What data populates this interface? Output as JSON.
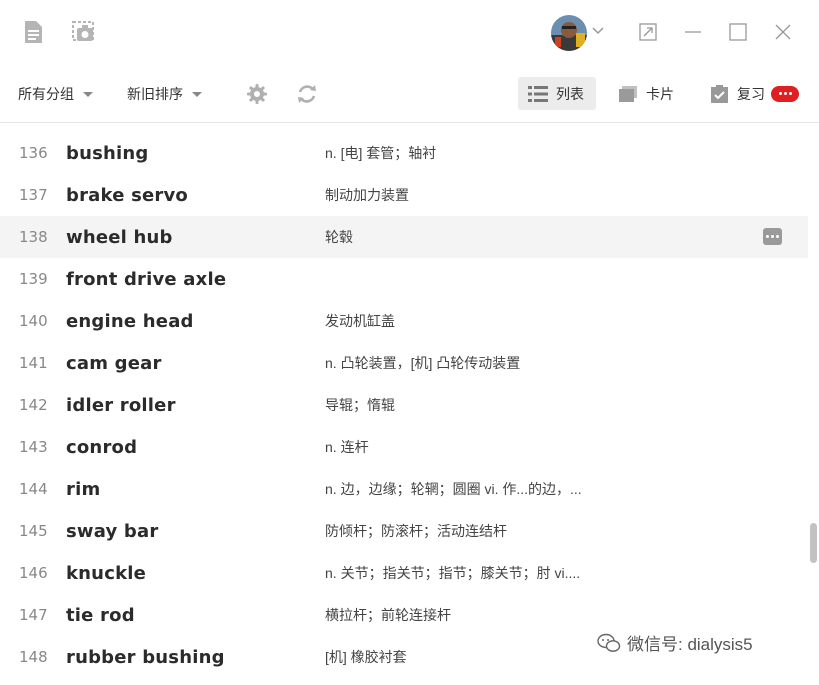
{
  "window": {
    "buttons": {
      "restore_icon": "restore-icon",
      "minimize_icon": "minimize-icon",
      "maximize_icon": "maximize-icon",
      "close_icon": "close-icon"
    }
  },
  "toolbar": {
    "group_filter": "所有分组",
    "sort_order": "新旧排序",
    "views": {
      "list_label": "列表",
      "card_label": "卡片",
      "review_label": "复习"
    }
  },
  "words": [
    {
      "num": "136",
      "word": "bushing",
      "definition": "n. [电] 套管；轴衬"
    },
    {
      "num": "137",
      "word": "brake servo",
      "definition": "制动加力装置"
    },
    {
      "num": "138",
      "word": "wheel hub",
      "definition": "轮毂"
    },
    {
      "num": "139",
      "word": "front drive axle",
      "definition": ""
    },
    {
      "num": "140",
      "word": "engine head",
      "definition": "发动机缸盖"
    },
    {
      "num": "141",
      "word": "cam gear",
      "definition": "n. 凸轮装置，[机] 凸轮传动装置"
    },
    {
      "num": "142",
      "word": "idler roller",
      "definition": "导辊；惰辊"
    },
    {
      "num": "143",
      "word": "conrod",
      "definition": "n. 连杆"
    },
    {
      "num": "144",
      "word": "rim",
      "definition": "n. 边，边缘；轮辋；圆圈  vi. 作...的边，..."
    },
    {
      "num": "145",
      "word": "sway bar",
      "definition": "防倾杆；防滚杆；活动连结杆"
    },
    {
      "num": "146",
      "word": "knuckle",
      "definition": "n. 关节；指关节；指节；膝关节；肘  vi...."
    },
    {
      "num": "147",
      "word": "tie rod",
      "definition": "横拉杆；前轮连接杆"
    },
    {
      "num": "148",
      "word": "rubber bushing",
      "definition": "[机] 橡胶衬套"
    }
  ],
  "watermark": "微信号: dialysis5",
  "colors": {
    "badge": "#e02020",
    "active_view_bg": "#ececec",
    "hover_row_bg": "#f4f4f4"
  }
}
